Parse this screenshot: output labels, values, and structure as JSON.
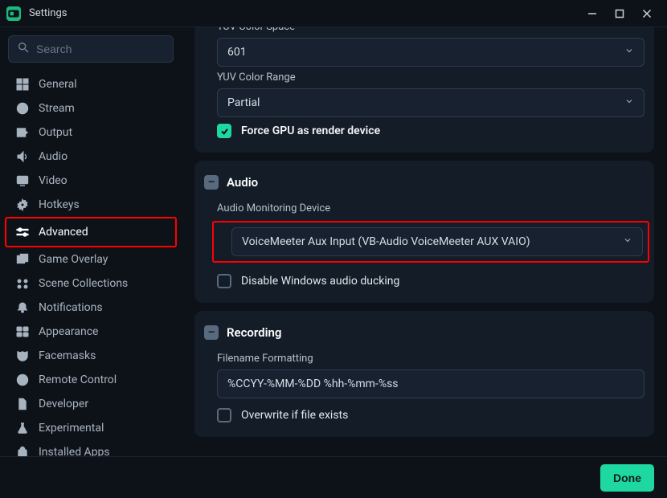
{
  "titlebar": {
    "title": "Settings"
  },
  "sidebar": {
    "search_placeholder": "Search",
    "items": [
      {
        "key": "general",
        "label": "General",
        "icon": "grid"
      },
      {
        "key": "stream",
        "label": "Stream",
        "icon": "globe"
      },
      {
        "key": "output",
        "label": "Output",
        "icon": "output"
      },
      {
        "key": "audio",
        "label": "Audio",
        "icon": "speaker"
      },
      {
        "key": "video",
        "label": "Video",
        "icon": "display"
      },
      {
        "key": "hotkeys",
        "label": "Hotkeys",
        "icon": "gear"
      },
      {
        "key": "advanced",
        "label": "Advanced",
        "icon": "sliders"
      },
      {
        "key": "game-overlay",
        "label": "Game Overlay",
        "icon": "overlay"
      },
      {
        "key": "scene-collections",
        "label": "Scene Collections",
        "icon": "collections"
      },
      {
        "key": "notifications",
        "label": "Notifications",
        "icon": "bell"
      },
      {
        "key": "appearance",
        "label": "Appearance",
        "icon": "appearance"
      },
      {
        "key": "facemasks",
        "label": "Facemasks",
        "icon": "mask"
      },
      {
        "key": "remote-control",
        "label": "Remote Control",
        "icon": "play-circle"
      },
      {
        "key": "developer",
        "label": "Developer",
        "icon": "doc"
      },
      {
        "key": "experimental",
        "label": "Experimental",
        "icon": "flask"
      },
      {
        "key": "installed-apps",
        "label": "Installed Apps",
        "icon": "bag"
      }
    ],
    "active_key": "advanced"
  },
  "content": {
    "video_tail": {
      "yuv_color_space_label": "YUV Color Space",
      "yuv_color_space_value": "601",
      "yuv_color_range_label": "YUV Color Range",
      "yuv_color_range_value": "Partial",
      "force_gpu_label": "Force GPU as render device",
      "force_gpu_checked": true
    },
    "audio_section": {
      "title": "Audio",
      "monitor_label": "Audio Monitoring Device",
      "monitor_value": "VoiceMeeter Aux Input (VB-Audio VoiceMeeter AUX VAIO)",
      "disable_ducking_label": "Disable Windows audio ducking",
      "disable_ducking_checked": false
    },
    "recording_section": {
      "title": "Recording",
      "filename_label": "Filename Formatting",
      "filename_value": "%CCYY-%MM-%DD %hh-%mm-%ss",
      "overwrite_label": "Overwrite if file exists",
      "overwrite_checked": false
    }
  },
  "footer": {
    "done_label": "Done"
  },
  "colors": {
    "accent": "#1ed8a2",
    "annotation": "#ff0000"
  }
}
